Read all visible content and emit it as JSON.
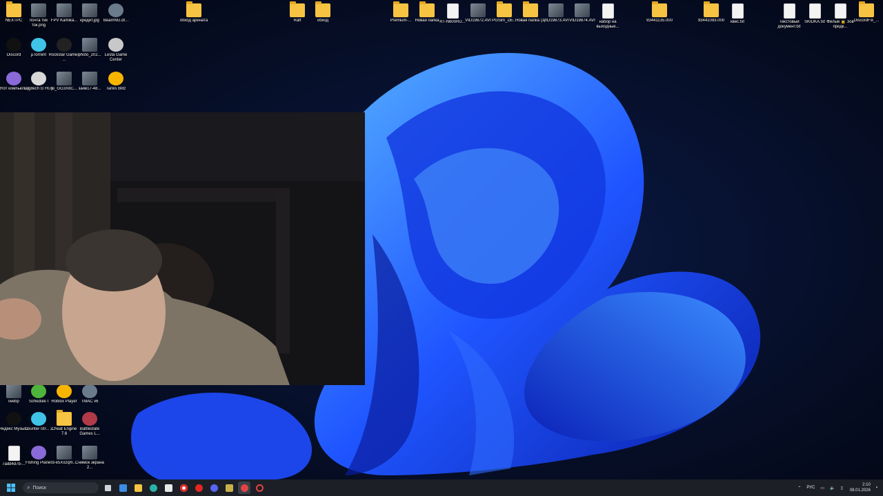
{
  "desktop_icons": [
    {
      "label": "NEXTPC",
      "kind": "folder"
    },
    {
      "label": "почта тик ток.png",
      "kind": "img"
    },
    {
      "label": "FPV Kamika...",
      "kind": "img"
    },
    {
      "label": "кредит.jpg",
      "kind": "img"
    },
    {
      "label": "BeamNG.dr...",
      "kind": "app"
    },
    {
      "label": "Discord",
      "kind": "app"
    },
    {
      "label": "µTorrent",
      "kind": "app"
    },
    {
      "label": "Rockstar Games ...",
      "kind": "app"
    },
    {
      "label": "photo_202...",
      "kind": "img"
    },
    {
      "label": "Lesta Game Center",
      "kind": "app"
    },
    {
      "label": "Этот компьютер",
      "kind": "app"
    },
    {
      "label": "Logitech G HUB",
      "kind": "app"
    },
    {
      "label": "jo_GG3X8C...",
      "kind": "img"
    },
    {
      "label": "заяв17-48...",
      "kind": "img"
    },
    {
      "label": "Tanks Blitz",
      "kind": "app"
    },
    {
      "label": "обход арената",
      "kind": "folder"
    },
    {
      "label": "Raft",
      "kind": "folder"
    },
    {
      "label": "обход",
      "kind": "folder"
    },
    {
      "label": "Premium-...",
      "kind": "folder"
    },
    {
      "label": "Новая папка",
      "kind": "folder"
    },
    {
      "label": "RT-N600RU...",
      "kind": "file"
    },
    {
      "label": "VID19872.AVI",
      "kind": "img"
    },
    {
      "label": "PGSim_DE...",
      "kind": "folder"
    },
    {
      "label": "Новая папка (2)",
      "kind": "folder"
    },
    {
      "label": "VID19873.AVI",
      "kind": "img"
    },
    {
      "label": "VID19874.AVI",
      "kind": "img"
    },
    {
      "label": "набор на выходные...",
      "kind": "file"
    },
    {
      "label": "93441135.000",
      "kind": "folder"
    },
    {
      "label": "93441093.000",
      "kind": "folder"
    },
    {
      "label": "квес.txt",
      "kind": "file"
    },
    {
      "label": "Текстовый документ.txt",
      "kind": "file"
    },
    {
      "label": "SKIDKA.txt",
      "kind": "file"
    },
    {
      "label": "Фильм 🔒 Зов предк...",
      "kind": "file"
    },
    {
      "label": "DiscordFix_...",
      "kind": "folder"
    },
    {
      "label": "iwebp",
      "kind": "img"
    },
    {
      "label": "Schedule I",
      "kind": "app"
    },
    {
      "label": "Roblox Player",
      "kind": "app"
    },
    {
      "label": "TMAC v6",
      "kind": "app"
    },
    {
      "label": "Яндекс Музыка",
      "kind": "app"
    },
    {
      "label": "Counter-Str... 2",
      "kind": "app"
    },
    {
      "label": "Cheat Engine 7.6",
      "kind": "folder"
    },
    {
      "label": "Battlestate Games L...",
      "kind": "app"
    },
    {
      "label": "7add4d7b-...",
      "kind": "file"
    },
    {
      "label": "Fishing Planet",
      "kind": "app"
    },
    {
      "label": "d-e5Xxzqm...",
      "kind": "img"
    },
    {
      "label": "Снимок экрана 2...",
      "kind": "img"
    }
  ],
  "taskbar": {
    "search_placeholder": "Поиск",
    "language": "РУС",
    "time": "2:10",
    "date": "08.01.2026"
  },
  "colors": {
    "taskbar_bg": "#1c1f26",
    "folder": "#f6c343",
    "wallpaper_accent": "#1f4dff"
  }
}
